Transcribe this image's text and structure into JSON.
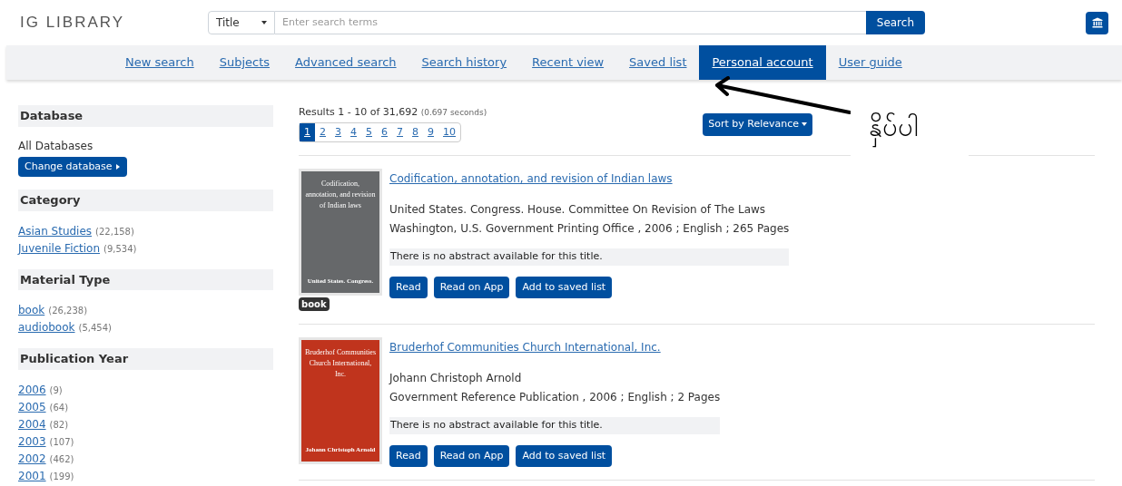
{
  "header": {
    "logo": "IG LIBRARY",
    "search_type": "Title",
    "search_placeholder": "Enter search terms",
    "search_button": "Search"
  },
  "nav": [
    {
      "label": "New search",
      "selected": false
    },
    {
      "label": "Subjects",
      "selected": false
    },
    {
      "label": "Advanced search",
      "selected": false
    },
    {
      "label": "Search history",
      "selected": false
    },
    {
      "label": "Recent view",
      "selected": false
    },
    {
      "label": "Saved list",
      "selected": false
    },
    {
      "label": "Personal account",
      "selected": true
    },
    {
      "label": "User guide",
      "selected": false
    }
  ],
  "annotation": {
    "label": "နှိပ်ပါ"
  },
  "sidebar": {
    "database": {
      "heading": "Database",
      "value": "All Databases",
      "button": "Change database"
    },
    "facets": [
      {
        "heading": "Category",
        "items": [
          {
            "label": "Asian Studies",
            "count": "(22,158)"
          },
          {
            "label": "Juvenile Fiction",
            "count": "(9,534)"
          }
        ]
      },
      {
        "heading": "Material Type",
        "items": [
          {
            "label": "book",
            "count": "(26,238)"
          },
          {
            "label": "audiobook",
            "count": "(5,454)"
          }
        ]
      },
      {
        "heading": "Publication Year",
        "items": [
          {
            "label": "2006",
            "count": "(9)"
          },
          {
            "label": "2005",
            "count": "(64)"
          },
          {
            "label": "2004",
            "count": "(82)"
          },
          {
            "label": "2003",
            "count": "(107)"
          },
          {
            "label": "2002",
            "count": "(462)"
          },
          {
            "label": "2001",
            "count": "(199)"
          }
        ]
      }
    ]
  },
  "results": {
    "summary": "Results 1 - 10 of 31,692",
    "time": "(0.697 seconds)",
    "pages": [
      {
        "label": "1",
        "selected": true
      },
      {
        "label": "2",
        "selected": false
      },
      {
        "label": "3",
        "selected": false
      },
      {
        "label": "4",
        "selected": false
      },
      {
        "label": "5",
        "selected": false
      },
      {
        "label": "6",
        "selected": false
      },
      {
        "label": "7",
        "selected": false
      },
      {
        "label": "8",
        "selected": false
      },
      {
        "label": "9",
        "selected": false
      },
      {
        "label": "10",
        "selected": false
      }
    ],
    "sort": "Sort by Relevance",
    "items": [
      {
        "title": "Codification, annotation, and revision of Indian laws",
        "author": "United States. Congress. House. Committee On Revision of The Laws",
        "publication": "Washington, U.S. Government Printing Office , 2006 ; English ; 265 Pages",
        "abstract": "There is no abstract available for this title.",
        "cover": {
          "title": "Codification, annotation, and revision of Indian laws",
          "author": "United States. Congress.",
          "color": "#66686a"
        },
        "badge": "book",
        "buttons": [
          "Read",
          "Read on App",
          "Add to saved list"
        ]
      },
      {
        "title": "Bruderhof Communities Church International, Inc.",
        "author": "Johann Christoph Arnold",
        "publication": "Government Reference Publication , 2006 ; English ; 2 Pages",
        "abstract": "There is no abstract available for this title.",
        "cover": {
          "title": "Bruderhof Communities Church International, Inc.",
          "author": "Johann Christoph Arnold",
          "color": "#c0341d"
        },
        "buttons": [
          "Read",
          "Read on App",
          "Add to saved list"
        ]
      }
    ]
  }
}
